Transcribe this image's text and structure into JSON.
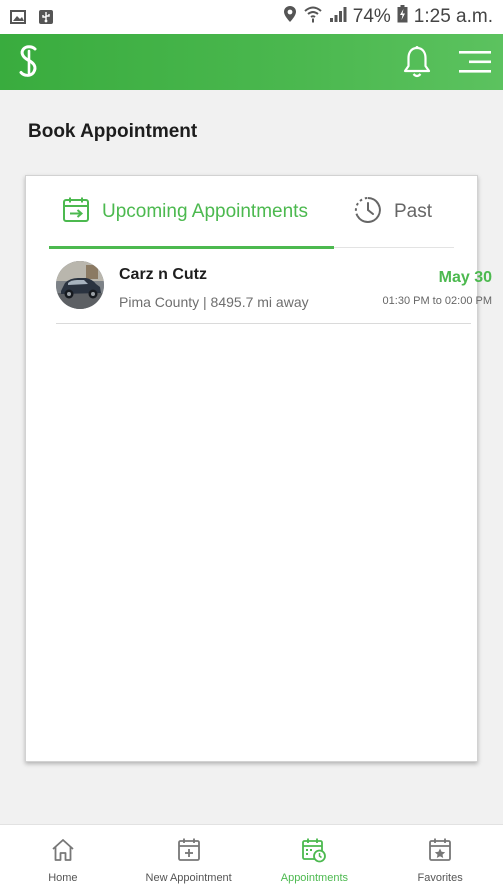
{
  "status_bar": {
    "battery": "74%",
    "time": "1:25 a.m."
  },
  "app_bar": {
    "logo_icon": "brand-s-logo",
    "notification_icon": "bell-icon",
    "menu_icon": "hamburger-menu-icon"
  },
  "page": {
    "title": "Book Appointment"
  },
  "tabs": [
    {
      "label": "Upcoming Appointments",
      "icon": "calendar-arrow-icon",
      "active": true
    },
    {
      "label": "Past",
      "icon": "clock-history-icon",
      "active": false
    }
  ],
  "appointments": [
    {
      "name": "Carz n Cutz",
      "location": "Pima County |  8495.7 mi away",
      "date": "May 30",
      "time": "01:30 PM to 02:00 PM",
      "avatar": "car-photo"
    }
  ],
  "bottom_nav": [
    {
      "label": "Home",
      "icon": "home-icon",
      "active": false
    },
    {
      "label": "New Appointment",
      "icon": "calendar-plus-icon",
      "active": false
    },
    {
      "label": "Appointments",
      "icon": "calendar-clock-icon",
      "active": true
    },
    {
      "label": "Favorites",
      "icon": "calendar-star-icon",
      "active": false
    }
  ],
  "colors": {
    "accent": "#4cb94f",
    "app_bar": "#43b247",
    "background": "#f1f1f1"
  }
}
